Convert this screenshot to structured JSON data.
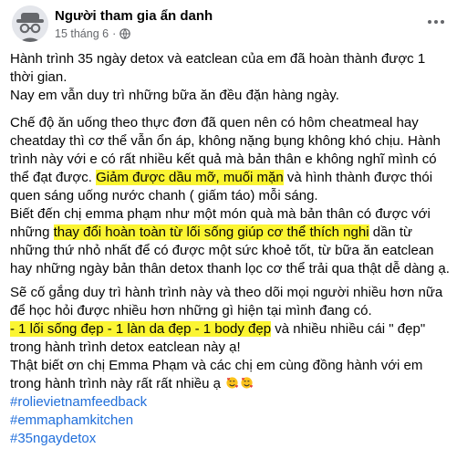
{
  "post": {
    "author": "Người tham gia ẩn danh",
    "date": "15 tháng 6",
    "separator": "·",
    "privacy_icon": "globe-icon",
    "more_icon": "more-options-icon",
    "avatar_icon": "anonymous-avatar-icon"
  },
  "body": {
    "p1": [
      "Hành trình 35 ngày detox và eatclean của em đã hoàn thành được 1",
      "thời gian.",
      "Nay em vẫn duy trì những bữa ăn đều đặn hàng ngày."
    ],
    "p2": {
      "l1": "Chế độ ăn uống theo thực đơn đã quen nên có hôm cheatmeal hay",
      "l2": "cheatday thì cơ thể vẫn ổn áp, không nặng bụng không khó chịu. Hành",
      "l3": "trình này với e có rất nhiều kết quả mà bản thân e không nghĩ mình có",
      "l4_pre": "thể đạt được. ",
      "l4_hl": "Giảm được dầu mỡ, muối mặn",
      "l4_post": " và hình thành được thói",
      "l5": "quen sáng uống nước chanh ( giấm táo) mỗi sáng.",
      "l6": "Biết đến chị emma phạm như một món quà mà bản thân có được với",
      "l7_pre": "những ",
      "l7_hl": "thay đổi hoàn toàn từ lối sống giúp cơ thể thích nghi",
      "l7_post": " dần từ",
      "l8": "những thứ nhỏ nhất để có được một sức khoẻ tốt, từ bữa ăn eatclean",
      "l9": "hay những ngày bản thân detox thanh lọc cơ thể trải qua thật dễ dàng ạ."
    },
    "p3": {
      "l1": "Sẽ cố gắng duy trì hành trình này và theo dõi mọi người nhiều hơn nữa",
      "l2": "để học hỏi được nhiều hơn những gì hiện tại mình đang có.",
      "l3_hl": "- 1 lối sống đẹp - 1 làn da đẹp - 1 body đẹp",
      "l3_post": " và nhiều nhiều cái \" đẹp\"",
      "l4": "trong hành trình detox eatclean này ạ!",
      "l5": "Thật biết ơn chị Emma Phạm và các chị em cùng đồng hành với em",
      "l6": "trong hành trình này rất rất nhiều ạ",
      "emoji_icon": "smiling-face-with-hearts-icon"
    },
    "hashtags": [
      "#rolievietnamfeedback",
      "#emmaphamkitchen",
      "#35ngaydetox"
    ]
  },
  "colors": {
    "highlight": "#fbf533",
    "hashtag": "#216fdb",
    "meta": "#65676b"
  }
}
